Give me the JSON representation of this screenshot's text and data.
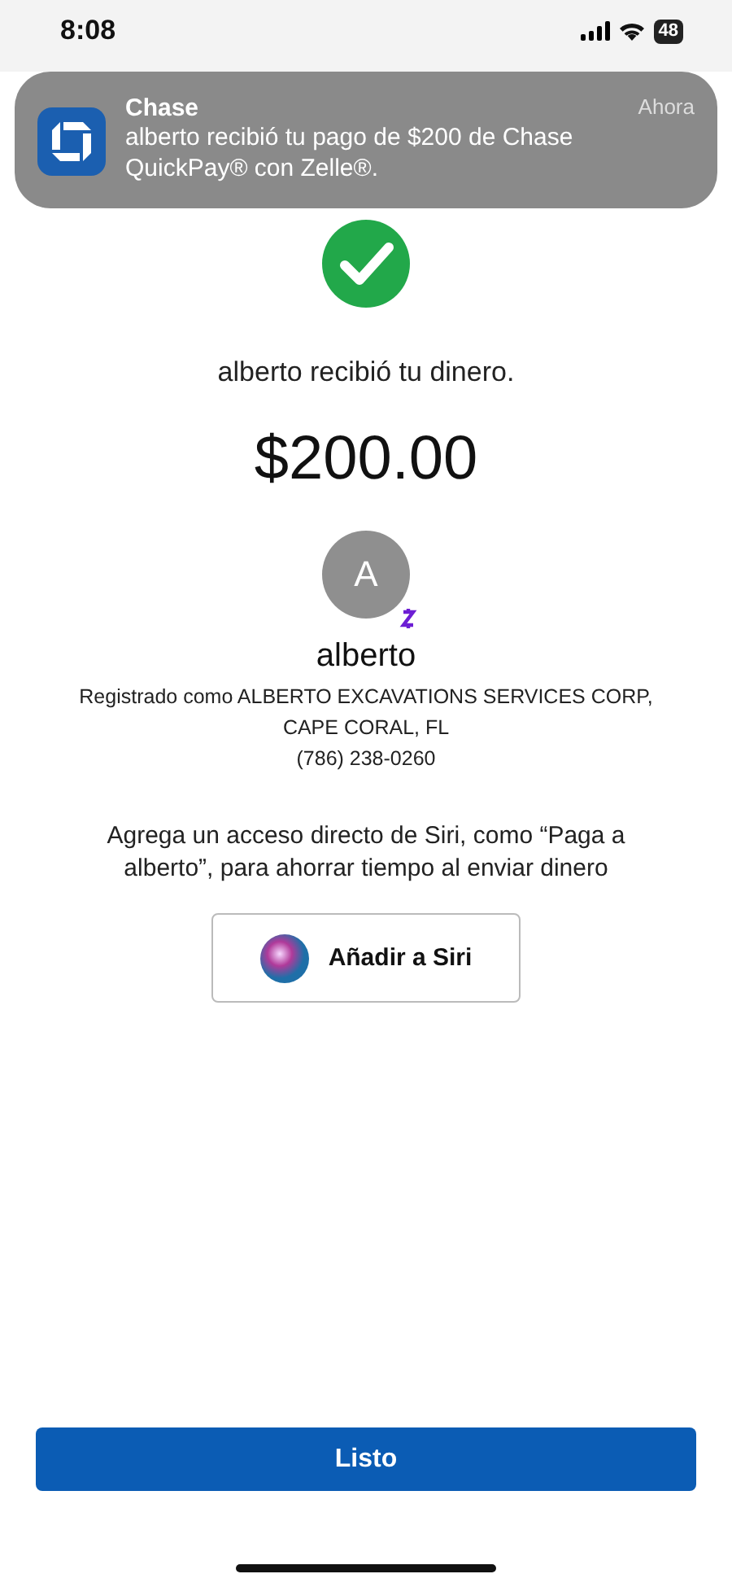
{
  "status_bar": {
    "time": "8:08",
    "battery": "48"
  },
  "notification": {
    "app": "Chase",
    "time": "Ahora",
    "message": "alberto recibió tu pago de $200 de Chase QuickPay® con Zelle®."
  },
  "confirmation": {
    "message": "alberto recibió tu dinero.",
    "amount": "$200.00"
  },
  "recipient": {
    "initial": "A",
    "name": "alberto",
    "details": [
      "Registrado como ALBERTO EXCAVATIONS SERVICES CORP,",
      "CAPE CORAL, FL",
      "(786) 238-0260"
    ]
  },
  "siri": {
    "prompt": "Agrega un acceso directo de Siri, como “Paga a alberto”, para ahorrar tiempo al enviar dinero",
    "button": "Añadir a Siri"
  },
  "done_button": "Listo"
}
